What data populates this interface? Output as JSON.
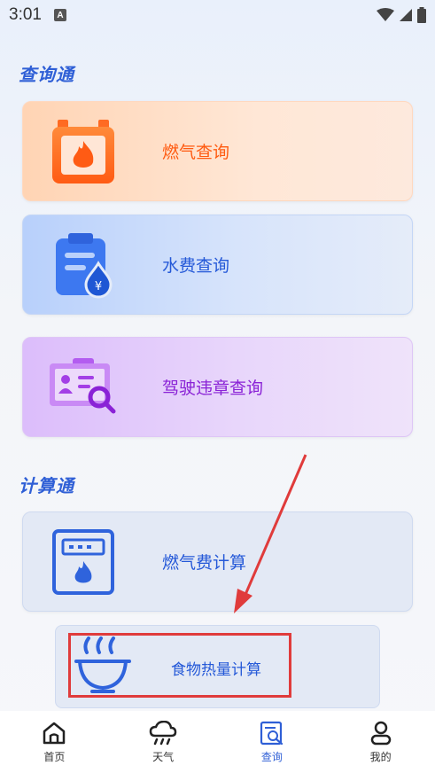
{
  "status_bar": {
    "time": "3:01",
    "notification_badge": "A"
  },
  "sections": {
    "query_title": "查询通",
    "calc_title": "计算通"
  },
  "query_cards": {
    "gas": {
      "label": "燃气查询",
      "icon": "gas-flame-icon"
    },
    "water": {
      "label": "水费查询",
      "icon": "water-bill-icon",
      "currency_symbol": "¥"
    },
    "driving": {
      "label": "驾驶违章查询",
      "icon": "license-search-icon"
    }
  },
  "calc_cards": {
    "gas_fee": {
      "label": "燃气费计算",
      "icon": "gas-meter-icon"
    },
    "food": {
      "label": "食物热量计算",
      "icon": "bowl-icon"
    }
  },
  "tabbar": {
    "items": [
      {
        "label": "首页",
        "icon": "home-icon"
      },
      {
        "label": "天气",
        "icon": "weather-icon"
      },
      {
        "label": "查询",
        "icon": "query-icon",
        "active": true
      },
      {
        "label": "我的",
        "icon": "profile-icon"
      }
    ]
  },
  "colors": {
    "accent": "#2f5fd6",
    "gas_orange": "#ff5a10",
    "drive_purple": "#8a22d6",
    "annotation_red": "#e03b3b"
  }
}
